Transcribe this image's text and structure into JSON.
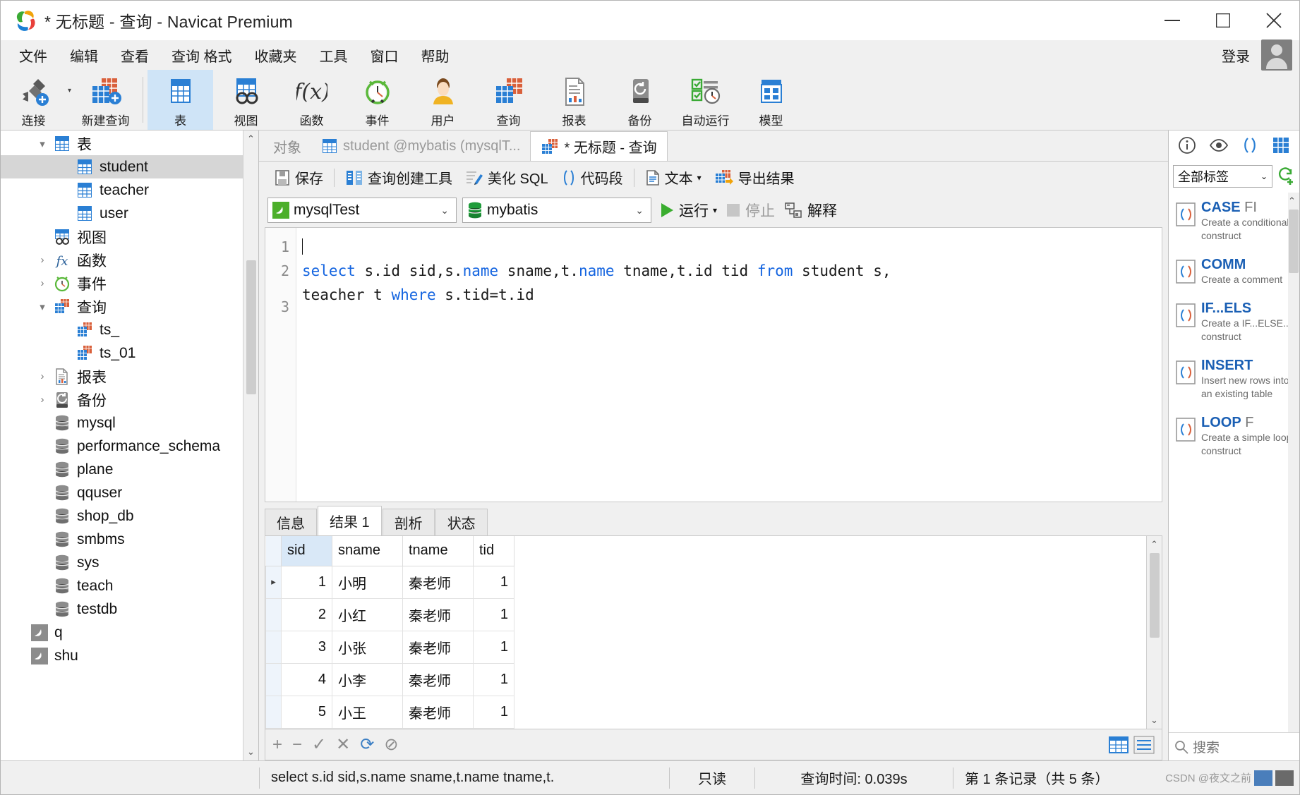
{
  "window": {
    "title": "* 无标题 - 查询 - Navicat Premium",
    "minimize": "–",
    "maximize": "□",
    "close": "✕"
  },
  "menubar": {
    "items": [
      "文件",
      "编辑",
      "查看",
      "查询 格式",
      "收藏夹",
      "工具",
      "窗口",
      "帮助"
    ],
    "login": "登录"
  },
  "toolbar": {
    "buttons": [
      {
        "label": "连接",
        "icon": "connection-icon",
        "selected": false
      },
      {
        "label": "新建查询",
        "icon": "new-query-icon",
        "selected": false
      },
      {
        "label": "表",
        "icon": "table-icon",
        "selected": true
      },
      {
        "label": "视图",
        "icon": "view-icon",
        "selected": false
      },
      {
        "label": "函数",
        "icon": "function-icon",
        "selected": false
      },
      {
        "label": "事件",
        "icon": "event-icon",
        "selected": false
      },
      {
        "label": "用户",
        "icon": "user-icon",
        "selected": false
      },
      {
        "label": "查询",
        "icon": "query-icon",
        "selected": false
      },
      {
        "label": "报表",
        "icon": "report-icon",
        "selected": false
      },
      {
        "label": "备份",
        "icon": "backup-icon",
        "selected": false
      },
      {
        "label": "自动运行",
        "icon": "automation-icon",
        "selected": false
      },
      {
        "label": "模型",
        "icon": "model-icon",
        "selected": false
      }
    ]
  },
  "sidebar": {
    "items": [
      {
        "label": "表",
        "indent": 1,
        "twisty": "▾",
        "icon": "table-icon",
        "selected": false
      },
      {
        "label": "student",
        "indent": 2,
        "twisty": "",
        "icon": "table-icon",
        "selected": true
      },
      {
        "label": "teacher",
        "indent": 2,
        "twisty": "",
        "icon": "table-icon",
        "selected": false
      },
      {
        "label": "user",
        "indent": 2,
        "twisty": "",
        "icon": "table-icon",
        "selected": false
      },
      {
        "label": "视图",
        "indent": 1,
        "twisty": "",
        "icon": "view-icon",
        "selected": false
      },
      {
        "label": "函数",
        "indent": 1,
        "twisty": "›",
        "icon": "function-icon",
        "selected": false
      },
      {
        "label": "事件",
        "indent": 1,
        "twisty": "›",
        "icon": "event-icon",
        "selected": false
      },
      {
        "label": "查询",
        "indent": 1,
        "twisty": "▾",
        "icon": "query-icon",
        "selected": false
      },
      {
        "label": "ts_",
        "indent": 2,
        "twisty": "",
        "icon": "query-icon",
        "selected": false
      },
      {
        "label": "ts_01",
        "indent": 2,
        "twisty": "",
        "icon": "query-icon",
        "selected": false
      },
      {
        "label": "报表",
        "indent": 1,
        "twisty": "›",
        "icon": "report-icon",
        "selected": false
      },
      {
        "label": "备份",
        "indent": 1,
        "twisty": "›",
        "icon": "backup-icon",
        "selected": false
      },
      {
        "label": "mysql",
        "indent": 1,
        "twisty": "",
        "icon": "database-icon",
        "selected": false
      },
      {
        "label": "performance_schema",
        "indent": 1,
        "twisty": "",
        "icon": "database-icon",
        "selected": false
      },
      {
        "label": "plane",
        "indent": 1,
        "twisty": "",
        "icon": "database-icon",
        "selected": false
      },
      {
        "label": "qquser",
        "indent": 1,
        "twisty": "",
        "icon": "database-icon",
        "selected": false
      },
      {
        "label": "shop_db",
        "indent": 1,
        "twisty": "",
        "icon": "database-icon",
        "selected": false
      },
      {
        "label": "smbms",
        "indent": 1,
        "twisty": "",
        "icon": "database-icon",
        "selected": false
      },
      {
        "label": "sys",
        "indent": 1,
        "twisty": "",
        "icon": "database-icon",
        "selected": false
      },
      {
        "label": "teach",
        "indent": 1,
        "twisty": "",
        "icon": "database-icon",
        "selected": false
      },
      {
        "label": "testdb",
        "indent": 1,
        "twisty": "",
        "icon": "database-icon",
        "selected": false
      },
      {
        "label": "q",
        "indent": 0,
        "twisty": "",
        "icon": "mysql-icon",
        "selected": false
      },
      {
        "label": "shu",
        "indent": 0,
        "twisty": "",
        "icon": "mysql-icon",
        "selected": false
      }
    ]
  },
  "tabs": {
    "object_tab": "对象",
    "table_tab": "student @mybatis (mysqlT...",
    "query_tab": "* 无标题 - 查询"
  },
  "query_toolbar": {
    "save": "保存",
    "query_builder": "查询创建工具",
    "beautify_sql": "美化 SQL",
    "code_snippet": "代码段",
    "text": "文本",
    "export_result": "导出结果"
  },
  "connection_bar": {
    "connection": "mysqlTest",
    "database": "mybatis",
    "run": "运行",
    "stop": "停止",
    "explain": "解释"
  },
  "editor": {
    "lines": [
      "1",
      "2",
      "3"
    ],
    "sql_plain": "select s.id sid,s.name sname,t.name tname,t.id tid from student s, teacher t where s.tid=t.id",
    "sql_tokens": [
      {
        "t": "select",
        "kw": true
      },
      {
        "t": " s.id sid,s.",
        "kw": false
      },
      {
        "t": "name",
        "kw": true
      },
      {
        "t": " sname,t.",
        "kw": false
      },
      {
        "t": "name",
        "kw": true
      },
      {
        "t": " tname,t.id tid ",
        "kw": false
      },
      {
        "t": "from",
        "kw": true
      },
      {
        "t": " student s,\nteacher t ",
        "kw": false
      },
      {
        "t": "where",
        "kw": true
      },
      {
        "t": " s.tid=t.id",
        "kw": false
      }
    ]
  },
  "results": {
    "tabs": [
      {
        "label": "信息",
        "active": false
      },
      {
        "label": "结果 1",
        "active": true
      },
      {
        "label": "剖析",
        "active": false
      },
      {
        "label": "状态",
        "active": false
      }
    ],
    "columns": [
      "sid",
      "sname",
      "tname",
      "tid"
    ],
    "rows": [
      {
        "marker": "▸",
        "sid": "1",
        "sname": "小明",
        "tname": "秦老师",
        "tid": "1"
      },
      {
        "marker": "",
        "sid": "2",
        "sname": "小红",
        "tname": "秦老师",
        "tid": "1"
      },
      {
        "marker": "",
        "sid": "3",
        "sname": "小张",
        "tname": "秦老师",
        "tid": "1"
      },
      {
        "marker": "",
        "sid": "4",
        "sname": "小李",
        "tname": "秦老师",
        "tid": "1"
      },
      {
        "marker": "",
        "sid": "5",
        "sname": "小王",
        "tname": "秦老师",
        "tid": "1"
      }
    ]
  },
  "grid_toolbar": {
    "add": "+",
    "remove": "−",
    "confirm": "✓",
    "cancel": "✕",
    "refresh": "⟳",
    "stop": "⊘"
  },
  "right_panel": {
    "tag_filter": "全部标签",
    "search_placeholder": "搜索",
    "snippets": [
      {
        "title": "CASE",
        "suffix": "FI",
        "desc": "Create a conditional construct"
      },
      {
        "title": "COMM",
        "suffix": "",
        "desc": "Create a comment"
      },
      {
        "title": "IF...ELS",
        "suffix": "",
        "desc": "Create a IF...ELSE... construct"
      },
      {
        "title": "INSERT",
        "suffix": "",
        "desc": "Insert new rows into an existing table"
      },
      {
        "title": "LOOP",
        "suffix": "F",
        "desc": "Create a simple loop construct"
      }
    ]
  },
  "statusbar": {
    "sql_echo": "select s.id sid,s.name sname,t.name tname,t.",
    "readonly": "只读",
    "query_time": "查询时间: 0.039s",
    "record_info": "第 1 条记录（共 5 条）",
    "watermark": "CSDN @夜文之前"
  },
  "colors": {
    "accent_blue": "#2a7fd4",
    "selection_blue": "#cfe4f7",
    "keyword_blue": "#1565e0",
    "run_green": "#3aad2f",
    "table_red": "#d9603b",
    "snippet_title": "#1a5fb4"
  }
}
